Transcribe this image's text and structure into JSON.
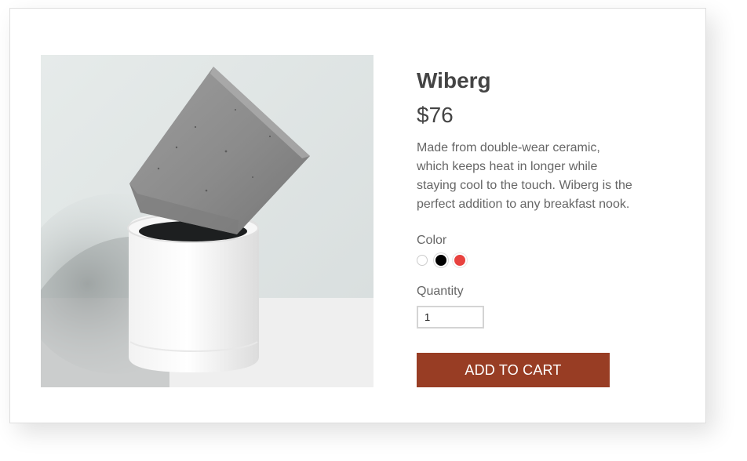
{
  "product": {
    "name": "Wiberg",
    "price": "$76",
    "description": "Made from double-wear ceramic, which keeps heat in longer while staying cool to the touch. Wiberg is the perfect addition to any breakfast nook."
  },
  "options": {
    "color_label": "Color",
    "colors": [
      {
        "name": "white",
        "hex": "#ffffff"
      },
      {
        "name": "black",
        "hex": "#000000"
      },
      {
        "name": "red",
        "hex": "#e8423f"
      }
    ],
    "quantity_label": "Quantity",
    "quantity_value": "1"
  },
  "actions": {
    "add_to_cart_label": "ADD TO CART"
  },
  "theme": {
    "button_color": "#983d24",
    "text_color": "#444444"
  }
}
